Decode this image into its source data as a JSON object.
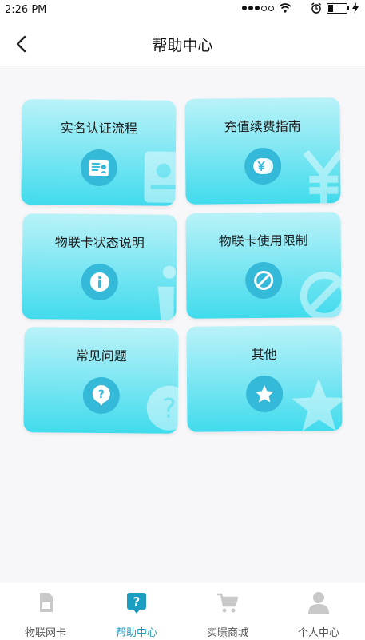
{
  "status_bar": {
    "time": "2:26 PM"
  },
  "header": {
    "title": "帮助中心"
  },
  "cards": [
    {
      "title": "实名认证流程"
    },
    {
      "title": "充值续费指南"
    },
    {
      "title": "物联卡状态说明"
    },
    {
      "title": "物联卡使用限制"
    },
    {
      "title": "常见问题"
    },
    {
      "title": "其他"
    }
  ],
  "tabbar": {
    "items": [
      {
        "label": "物联网卡",
        "icon": "sim-card-icon"
      },
      {
        "label": "帮助中心",
        "icon": "help-icon",
        "active": true
      },
      {
        "label": "实暻商城",
        "icon": "cart-icon"
      },
      {
        "label": "个人中心",
        "icon": "person-icon"
      }
    ]
  },
  "colors": {
    "accent": "#1b9ec2",
    "card_icon": "#35b9d9",
    "card_gradient_end": "#41dbed"
  }
}
